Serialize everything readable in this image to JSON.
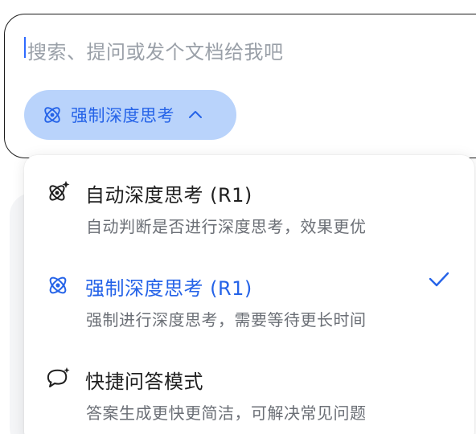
{
  "input": {
    "placeholder": "搜索、提问或发个文档给我吧"
  },
  "mode_pill": {
    "label": "强制深度思考",
    "icon": "atom-icon",
    "chevron": "chevron-up-icon"
  },
  "menu": {
    "options": [
      {
        "title": "自动深度思考 (R1)",
        "description": "自动判断是否进行深度思考，效果更优",
        "icon": "atom-sparkle-icon",
        "selected": false
      },
      {
        "title": "强制深度思考 (R1)",
        "description": "强制进行深度思考，需要等待更长时间",
        "icon": "atom-icon",
        "selected": true
      },
      {
        "title": "快捷问答模式",
        "description": "答案生成更快更简洁，可解决常见问题",
        "icon": "chat-bubble-icon",
        "selected": false
      }
    ],
    "selected_indicator": "checkmark-icon"
  },
  "colors": {
    "accent": "#2563e8",
    "pill_bg": "#b9d3fb",
    "text_primary": "#1f1f1f",
    "text_secondary": "#6b6f76",
    "placeholder": "#9aa0a8"
  }
}
